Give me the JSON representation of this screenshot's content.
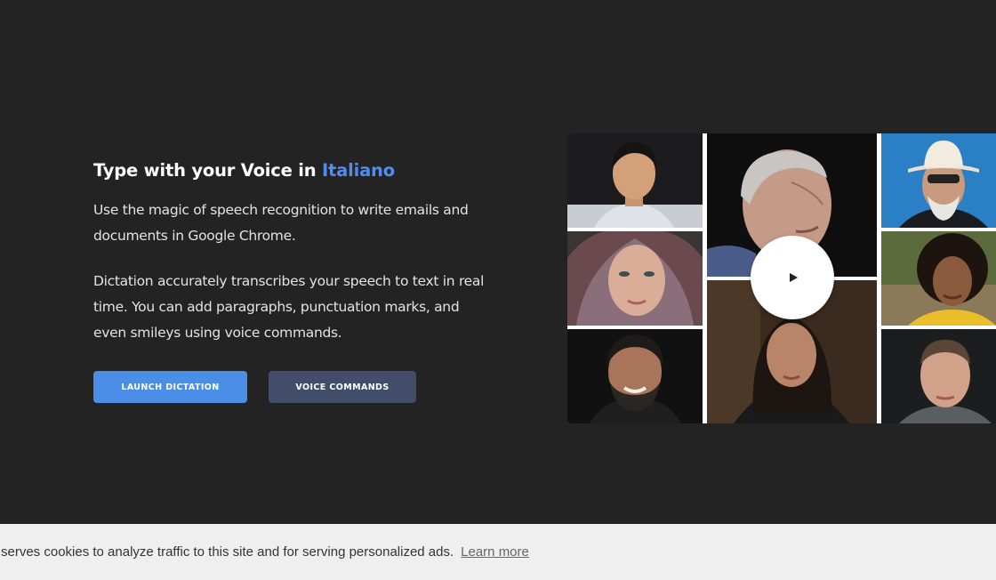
{
  "hero": {
    "title_prefix": "Type with your Voice in ",
    "title_language": "Italiano",
    "paragraph_1": "Use the magic of speech recognition to write emails and documents in Google Chrome.",
    "paragraph_2": "Dictation accurately transcribes your speech to text in real time. You can add paragraphs, punctuation marks, and even smileys using voice commands."
  },
  "buttons": {
    "launch_label": "LAUNCH DICTATION",
    "commands_label": "VOICE COMMANDS"
  },
  "video": {
    "play_icon": "play-icon",
    "tiles": [
      "portrait-young-man",
      "portrait-elderly-man",
      "portrait-man-cowboy-hat",
      "portrait-woman-headscarf",
      "portrait-woman-curly-hair",
      "portrait-smiling-bearded-man",
      "portrait-woman-dark-hair",
      "portrait-man-short-hair"
    ]
  },
  "cookie_banner": {
    "text": "serves cookies to analyze traffic to this site and for serving personalized ads.",
    "link_label": "Learn more"
  },
  "colors": {
    "background": "#232324",
    "accent": "#4a8ee8",
    "language_highlight": "#4f8ef0",
    "secondary_button": "#414d69",
    "cookie_background": "#efefef"
  }
}
